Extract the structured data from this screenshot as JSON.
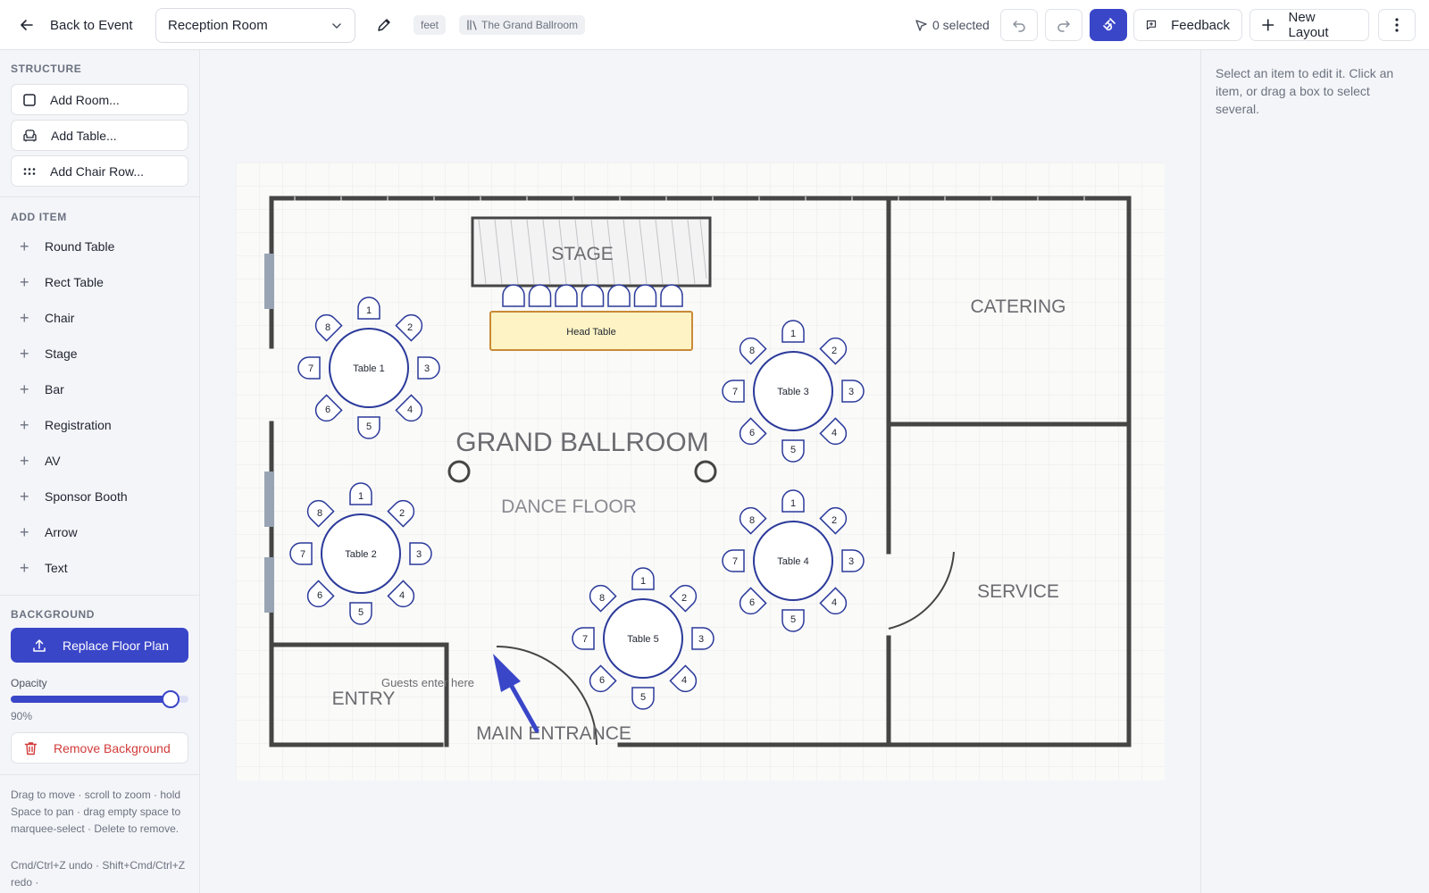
{
  "header": {
    "back_label": "Back to Event",
    "room_select": "Reception Room",
    "unit_chip": "feet",
    "venue_chip": "The Grand Ballroom",
    "selected_count": "0 selected",
    "feedback_label": "Feedback",
    "new_layout_label": "New Layout"
  },
  "sidebar": {
    "structure_title": "STRUCTURE",
    "structure_items": [
      "Add Room...",
      "Add Table...",
      "Add Chair Row..."
    ],
    "add_item_title": "ADD ITEM",
    "add_items": [
      "Round Table",
      "Rect Table",
      "Chair",
      "Stage",
      "Bar",
      "Registration",
      "AV",
      "Sponsor Booth",
      "Arrow",
      "Text"
    ],
    "background_title": "BACKGROUND",
    "replace_label": "Replace Floor Plan",
    "opacity_label": "Opacity",
    "opacity_value": 90,
    "opacity_text": "90%",
    "remove_label": "Remove Background",
    "help_1": "Drag to move · scroll to zoom · hold Space to pan · drag empty space to marquee-select · Delete to remove.",
    "help_2": "Cmd/Ctrl+Z undo · Shift+Cmd/Ctrl+Z redo ·"
  },
  "right_panel": {
    "hint": "Select an item to edit it. Click an item, or drag a box to select several."
  },
  "floor_plan": {
    "stage_label": "STAGE",
    "head_table_label": "Head Table",
    "ballroom_label": "GRAND BALLROOM",
    "dance_floor_label": "DANCE FLOOR",
    "catering_label": "CATERING",
    "service_label": "SERVICE",
    "entry_label": "ENTRY",
    "main_entrance_label": "MAIN ENTRANCE",
    "guests_label": "Guests enter here",
    "tables": [
      {
        "label": "Table 1",
        "seats": [
          "1",
          "2",
          "3",
          "4",
          "5",
          "6",
          "7",
          "8"
        ]
      },
      {
        "label": "Table 2",
        "seats": [
          "1",
          "2",
          "3",
          "4",
          "5",
          "6",
          "7",
          "8"
        ]
      },
      {
        "label": "Table 3",
        "seats": [
          "1",
          "2",
          "3",
          "4",
          "5",
          "6",
          "7",
          "8"
        ]
      },
      {
        "label": "Table 4",
        "seats": [
          "1",
          "2",
          "3",
          "4",
          "5",
          "6",
          "7",
          "8"
        ]
      },
      {
        "label": "Table 5",
        "seats": [
          "1",
          "2",
          "3",
          "4",
          "5",
          "6",
          "7",
          "8"
        ]
      }
    ]
  },
  "colors": {
    "accent": "#3a46c8",
    "danger": "#d23b3b",
    "wall": "#454545",
    "table_stroke": "#2b3a9a",
    "head_table_fill": "#fdf3c4",
    "head_table_stroke": "#c98a35"
  }
}
